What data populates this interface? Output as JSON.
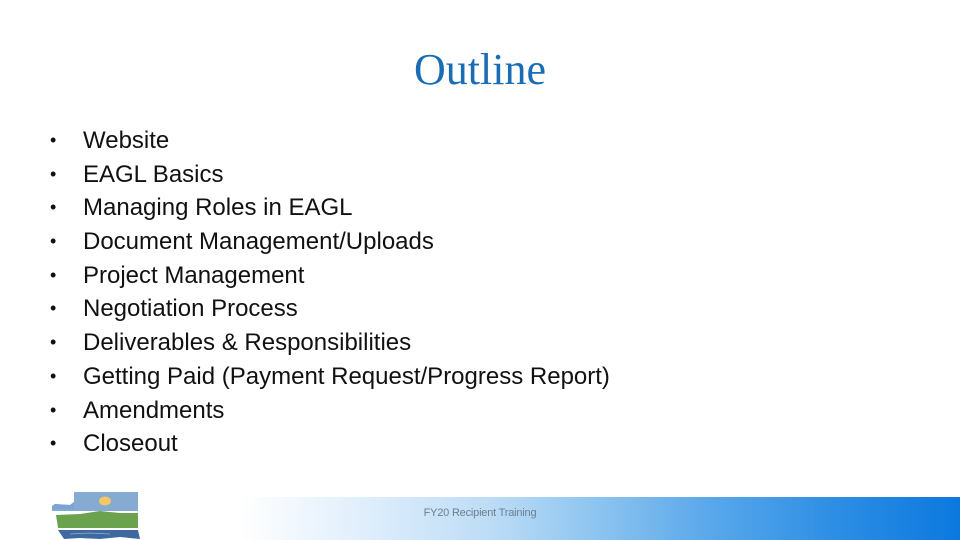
{
  "slide": {
    "title": "Outline",
    "bullets": [
      {
        "label": "Website"
      },
      {
        "label": "EAGL Basics"
      },
      {
        "label": "Managing Roles in EAGL"
      },
      {
        "label": "Document Management/Uploads"
      },
      {
        "label": "Project Management"
      },
      {
        "label": "Negotiation Process"
      },
      {
        "label": "Deliverables & Responsibilities"
      },
      {
        "label": "Getting Paid (Payment Request/Progress Report)"
      },
      {
        "label": "Amendments"
      },
      {
        "label": "Closeout"
      }
    ],
    "bullet_glyph": "•",
    "footer_text": "FY20 Recipient Training",
    "logo_icon": "washington-state-ecology-logo-icon"
  },
  "colors": {
    "title": "#1a6db5",
    "text": "#111111",
    "footer_gradient_end": "#0b78df",
    "footer_text": "#6b7f92"
  }
}
